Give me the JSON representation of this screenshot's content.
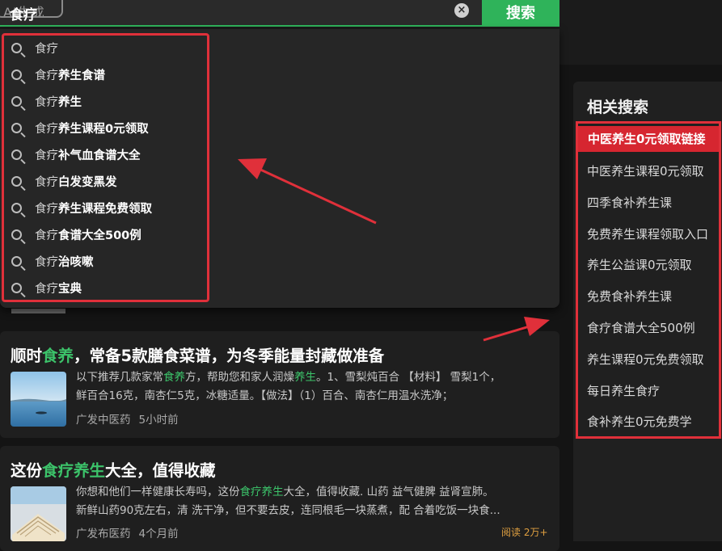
{
  "search": {
    "logo_text": "AI生成",
    "query": "食疗",
    "clear_icon": "close-circle-icon",
    "button_label": "搜索"
  },
  "suggestions": {
    "items": [
      {
        "prefix": "食疗",
        "rest": ""
      },
      {
        "prefix": "食疗",
        "rest": "养生食谱"
      },
      {
        "prefix": "食疗",
        "rest": "养生"
      },
      {
        "prefix": "食疗",
        "rest": "养生课程0元领取"
      },
      {
        "prefix": "食疗",
        "rest": "补气血食谱大全"
      },
      {
        "prefix": "食疗",
        "rest": "白发变黑发"
      },
      {
        "prefix": "食疗",
        "rest": "养生课程免费领取"
      },
      {
        "prefix": "食疗",
        "rest": "食谱大全500例"
      },
      {
        "prefix": "食疗",
        "rest": "治咳嗽"
      },
      {
        "prefix": "食疗",
        "rest": "宝典"
      }
    ]
  },
  "results": [
    {
      "title_a": "顺时",
      "title_hl": "食养",
      "title_b": "，常备5款膳食菜谱，为冬季能量封藏做准备",
      "snippet1_a": "以下推荐几款家常",
      "snippet1_hl": "食养",
      "snippet1_b": "方，帮助您和家人润燥",
      "snippet1_hl2": "养生",
      "snippet1_c": "。1、雪梨炖百合 【材料】 雪梨1个，",
      "snippet2": "鲜百合16克，南杏仁5克，冰糖适量。【做法】（1）百合、南杏仁用温水洗净；",
      "source": "广发中医药",
      "time": "5小时前"
    },
    {
      "title_a": "这份",
      "title_hl": "食疗养生",
      "title_b": "大全，值得收藏",
      "snippet1_a": "你想和他们一样健康长寿吗，这份",
      "snippet1_hl": "食疗养生",
      "snippet1_b": "大全，值得收藏. 山药 益气健脾 益肾宣肺。",
      "snippet2": "新鲜山药90克左右，清 洗干净，但不要去皮，连同根毛一块蒸煮，配 合着吃饭一块食...",
      "source": "广发布医药",
      "time": "4个月前",
      "tag": "阅读 2万+"
    }
  ],
  "related": {
    "title": "相关搜索",
    "items": [
      "中医养生0元领取链接",
      "中医养生课程0元领取",
      "四季食补养生课",
      "免费养生课程领取入口",
      "养生公益课0元领取",
      "免费食补养生课",
      "食疗食谱大全500例",
      "养生课程0元免费领取",
      "每日养生食疗",
      "食补养生0元免费学"
    ]
  },
  "colors": {
    "accent_green": "#2fb35a",
    "annotation_red": "#e0303a",
    "highlight_text": "#3cc36a"
  }
}
